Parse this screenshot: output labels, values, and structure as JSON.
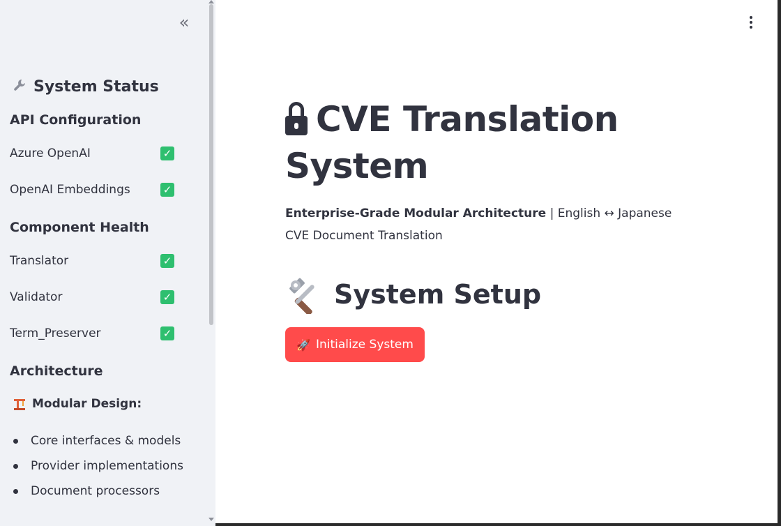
{
  "sidebar": {
    "collapse_icon": "«",
    "status_icon": "wrench-icon",
    "status_title": "System Status",
    "api_heading": "API Configuration",
    "api_items": [
      {
        "label": "Azure OpenAI",
        "status": "✓"
      },
      {
        "label": "OpenAI Embeddings",
        "status": "✓"
      }
    ],
    "health_heading": "Component Health",
    "health_items": [
      {
        "label": "Translator",
        "status": "✓"
      },
      {
        "label": "Validator",
        "status": "✓"
      },
      {
        "label": "Term_Preserver",
        "status": "✓"
      }
    ],
    "arch_heading": "Architecture",
    "modular_label": "Modular Design:",
    "arch_items": [
      "Core interfaces & models",
      "Provider implementations",
      "Document processors"
    ]
  },
  "main": {
    "title": "CVE Translation System",
    "subtitle_bold": "Enterprise-Grade Modular Architecture",
    "subtitle_rest": " | English ↔ Japanese CVE Document Translation",
    "setup_title": "System Setup",
    "init_button_icon": "🚀",
    "init_button_label": "Initialize System"
  },
  "colors": {
    "sidebar_bg": "#f0f2f6",
    "text": "#31333f",
    "check": "#2ebf6f",
    "primary_button": "#ff4b4b"
  }
}
